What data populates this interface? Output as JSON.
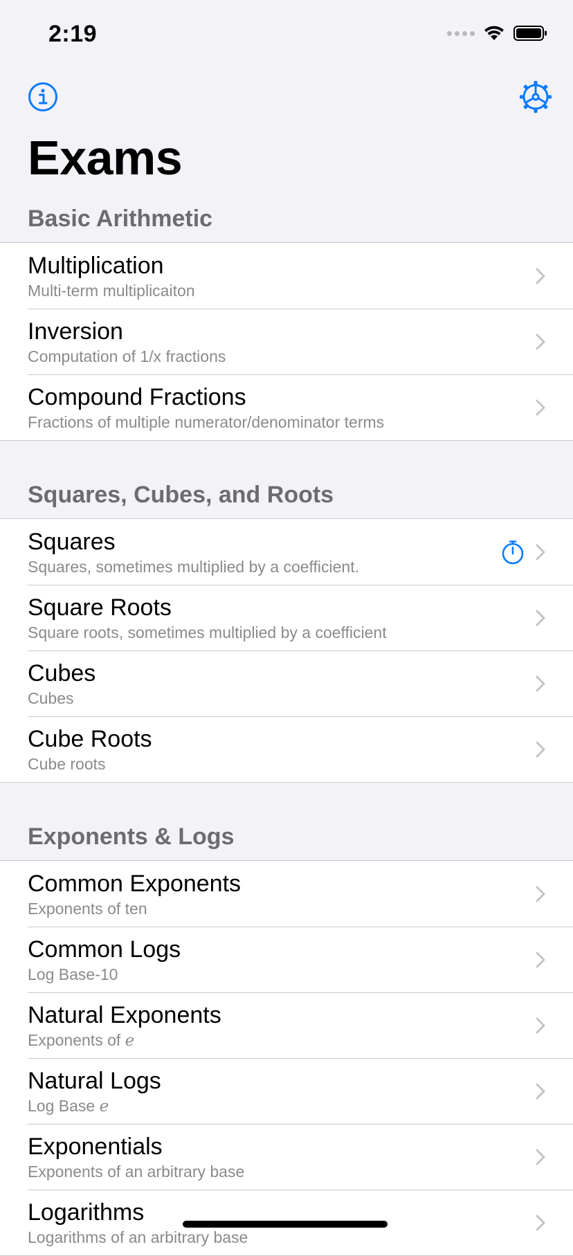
{
  "status_bar": {
    "time": "2:19"
  },
  "nav": {
    "info_icon": "info-icon",
    "settings_icon": "gear-icon"
  },
  "page": {
    "title": "Exams"
  },
  "accent_color": "#0a7aff",
  "sections": [
    {
      "title": "Basic Arithmetic",
      "items": [
        {
          "title": "Multiplication",
          "subtitle": "Multi-term multiplicaiton"
        },
        {
          "title": "Inversion",
          "subtitle": "Computation of 1/x fractions"
        },
        {
          "title": "Compound Fractions",
          "subtitle": "Fractions of multiple numerator/denominator terms"
        }
      ]
    },
    {
      "title": "Squares, Cubes, and Roots",
      "items": [
        {
          "title": "Squares",
          "subtitle": "Squares, sometimes multiplied by a coefficient.",
          "timer": true
        },
        {
          "title": "Square Roots",
          "subtitle": "Square roots, sometimes multiplied by a coefficient"
        },
        {
          "title": "Cubes",
          "subtitle": "Cubes"
        },
        {
          "title": "Cube Roots",
          "subtitle": "Cube roots"
        }
      ]
    },
    {
      "title": "Exponents & Logs",
      "items": [
        {
          "title": "Common Exponents",
          "subtitle": "Exponents of ten"
        },
        {
          "title": "Common Logs",
          "subtitle": "Log Base-10"
        },
        {
          "title": "Natural Exponents",
          "subtitle": "Exponents of ",
          "subtitle_italic": "e"
        },
        {
          "title": "Natural Logs",
          "subtitle": "Log Base ",
          "subtitle_italic": "e"
        },
        {
          "title": "Exponentials",
          "subtitle": "Exponents of an arbitrary base"
        },
        {
          "title": "Logarithms",
          "subtitle": "Logarithms of an arbitrary base"
        }
      ]
    }
  ]
}
